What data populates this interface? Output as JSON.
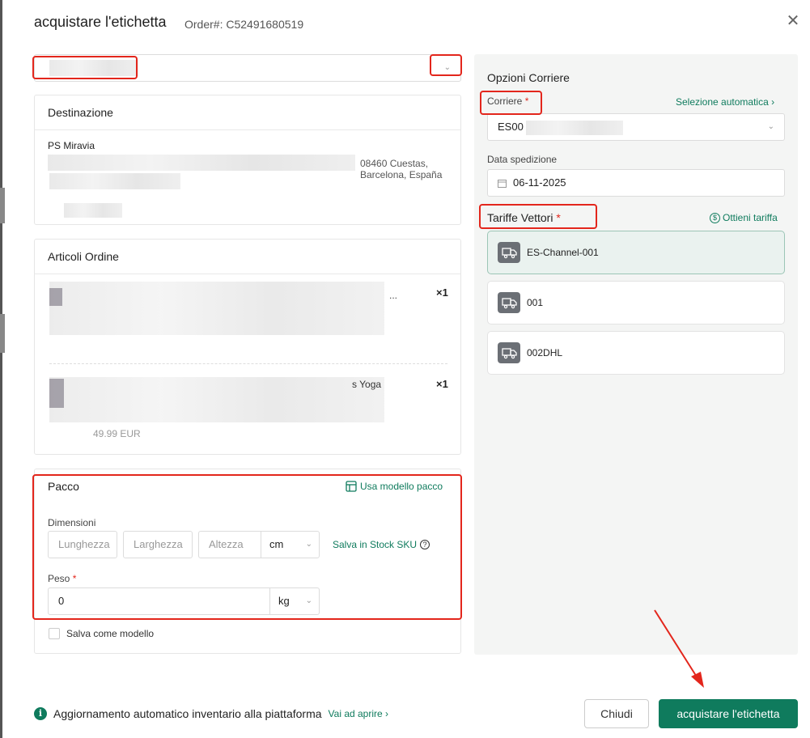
{
  "header": {
    "title": "acquistare l'etichetta",
    "order_label": "Order#: C52491680519",
    "close_glyph": "✕"
  },
  "destination": {
    "title": "Destinazione",
    "name": "PS Miravia",
    "country": "08460 Cuestas, Barcelona, España"
  },
  "articles": {
    "title": "Articoli Ordine",
    "items": [
      {
        "qty": "×1",
        "fragment": "..."
      },
      {
        "qty": "×1",
        "fragment": "s Yoga",
        "price": "49.99 EUR"
      }
    ]
  },
  "package": {
    "title": "Pacco",
    "template_link": "Usa modello pacco",
    "dimensions_label": "Dimensioni",
    "length_placeholder": "Lunghezza",
    "width_placeholder": "Larghezza",
    "height_placeholder": "Altezza",
    "dim_unit": "cm",
    "save_stock_link": "Salva in Stock SKU",
    "weight_label": "Peso",
    "required_mark": "*",
    "weight_value": "0",
    "weight_unit": "kg",
    "save_template_label": "Salva come modello"
  },
  "carrier_options": {
    "title": "Opzioni Corriere",
    "carrier_label": "Corriere",
    "auto_select_link": "Selezione automatica",
    "carrier_value": "ES00",
    "ship_date_label": "Data spedizione",
    "ship_date_value": "06-11-2025",
    "rates_title": "Tariffe Vettori",
    "get_rate_link": "Ottieni tariffa",
    "rates": [
      {
        "label": "ES-Channel-001"
      },
      {
        "label": "001"
      },
      {
        "label": "002DHL"
      }
    ]
  },
  "footer": {
    "info_text": "Aggiornamento automatico inventario alla piattaforma",
    "go_open_link": "Vai ad aprire",
    "close_button": "Chiudi",
    "buy_button": "acquistare l'etichetta"
  },
  "colors": {
    "accent": "#0f7b5d",
    "annotation_red": "#e3261c"
  }
}
